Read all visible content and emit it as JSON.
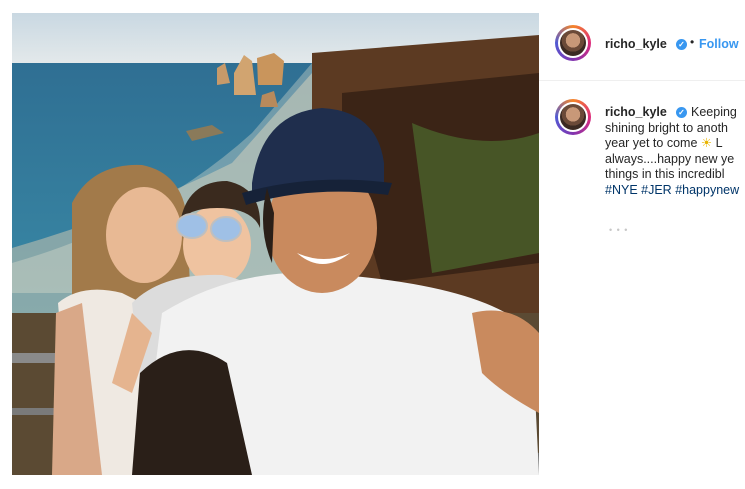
{
  "post": {
    "username": "richo_kyle",
    "follow_label": "Follow",
    "separator": "•",
    "verified_mark": "✓"
  },
  "caption": {
    "username": "richo_kyle",
    "lines": [
      "Keeping",
      "shining bright to anoth",
      "year yet to come",
      "L",
      "always....happy new ye",
      "things in this incredibl",
      "#NYE #JER #happynew"
    ],
    "sun_emoji": "☀",
    "hashtags": [
      "#NYE",
      "#JER",
      "#happynew"
    ],
    "more": "• • •"
  },
  "colors": {
    "accent": "#3897f0",
    "hashtag": "#003569",
    "text": "#262626"
  },
  "icons": [
    "verified-badge-icon",
    "sun-emoji-icon",
    "avatar-ring"
  ]
}
